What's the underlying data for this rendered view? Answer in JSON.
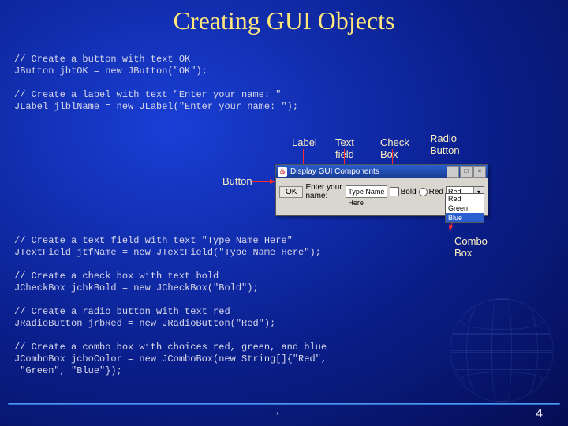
{
  "title": "Creating GUI Objects",
  "code1": "// Create a button with text OK\nJButton jbtOK = new JButton(\"OK\");\n\n// Create a label with text \"Enter your name: \"\nJLabel jlblName = new JLabel(\"Enter your name: \");",
  "code2": "// Create a text field with text \"Type Name Here\"\nJTextField jtfName = new JTextField(\"Type Name Here\");\n\n// Create a check box with text bold\nJCheckBox jchkBold = new JCheckBox(\"Bold\");\n\n// Create a radio button with text red\nJRadioButton jrbRed = new JRadioButton(\"Red\");\n\n// Create a combo box with choices red, green, and blue\nJComboBox jcboColor = new JComboBox(new String[]{\"Red\",\n \"Green\", \"Blue\"});",
  "annotations": {
    "button": "Button",
    "label": "Label",
    "text": "Text\nfield",
    "check": "Check\nBox",
    "radio": "Radio\nButton",
    "combo": "Combo\nBox"
  },
  "window": {
    "title": "Display GUI Components",
    "ok": "OK",
    "label": "Enter your name:",
    "textfield": "Type Name Here",
    "checkbox": "Bold",
    "radio": "Red",
    "combo_value": "Red",
    "combo_items": [
      "Red",
      "Green",
      "Blue"
    ],
    "combo_selected": "Blue"
  },
  "page_number": "4",
  "asterisk": "*"
}
